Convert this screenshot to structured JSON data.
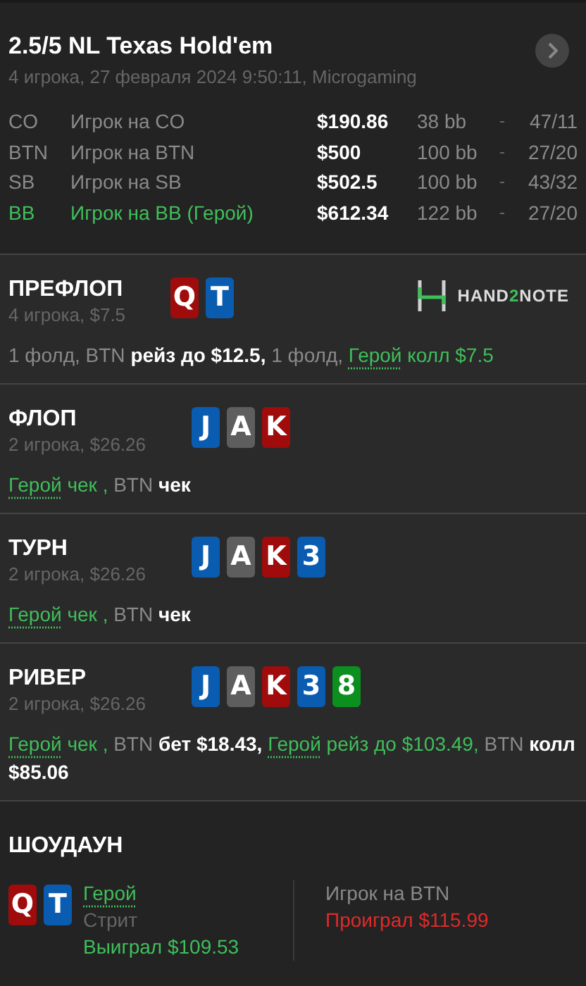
{
  "header": {
    "title": "2.5/5 NL Texas Hold'em",
    "subtitle": "4 игрока, 27 февраля 2024 9:50:11, Microgaming"
  },
  "players": [
    {
      "position": "CO",
      "name": "Игрок на CO",
      "stack": "$190.86",
      "bb": "38 bb",
      "stats": "47/11",
      "hero": false
    },
    {
      "position": "BTN",
      "name": "Игрок на BTN",
      "stack": "$500",
      "bb": "100 bb",
      "stats": "27/20",
      "hero": false
    },
    {
      "position": "SB",
      "name": "Игрок на SB",
      "stack": "$502.5",
      "bb": "100 bb",
      "stats": "43/32",
      "hero": false
    },
    {
      "position": "BB",
      "name": "Игрок на BB (Герой)",
      "stack": "$612.34",
      "bb": "122 bb",
      "stats": "27/20",
      "hero": true
    }
  ],
  "streets": [
    {
      "title": "ПРЕФЛОП",
      "info": "4 игрока, $7.5",
      "logo": {
        "parts": [
          {
            "text": "HAND",
            "accent": false
          },
          {
            "text": "2",
            "accent": true
          },
          {
            "text": "NOTE",
            "accent": false
          }
        ]
      },
      "cards": [
        {
          "rank": "Q",
          "color": "#a00c0c"
        },
        {
          "rank": "T",
          "color": "#0a5cb0"
        }
      ],
      "actions": [
        {
          "text": "1 фолд, BTN ",
          "kind": "muted"
        },
        {
          "text": "рейз до $12.5,",
          "kind": "bold"
        },
        {
          "text": " 1 фолд, ",
          "kind": "muted"
        },
        {
          "text": "Герой",
          "kind": "link"
        },
        {
          "text": " колл $7.5",
          "kind": "hero"
        }
      ]
    },
    {
      "title": "ФЛОП",
      "info": "2 игрока, $26.26",
      "cards": [
        {
          "rank": "J",
          "color": "#0a5cb0"
        },
        {
          "rank": "A",
          "color": "#5e5e5e"
        },
        {
          "rank": "K",
          "color": "#a00c0c"
        }
      ],
      "actions": [
        {
          "text": "Герой",
          "kind": "link"
        },
        {
          "text": " чек ,",
          "kind": "hero"
        },
        {
          "text": " BTN ",
          "kind": "muted"
        },
        {
          "text": "чек",
          "kind": "bold"
        }
      ]
    },
    {
      "title": "ТУРН",
      "info": "2 игрока, $26.26",
      "cards": [
        {
          "rank": "J",
          "color": "#0a5cb0"
        },
        {
          "rank": "A",
          "color": "#5e5e5e"
        },
        {
          "rank": "K",
          "color": "#a00c0c"
        },
        {
          "rank": "3",
          "color": "#0a5cb0"
        }
      ],
      "actions": [
        {
          "text": "Герой",
          "kind": "link"
        },
        {
          "text": " чек ,",
          "kind": "hero"
        },
        {
          "text": " BTN ",
          "kind": "muted"
        },
        {
          "text": "чек",
          "kind": "bold"
        }
      ]
    },
    {
      "title": "РИВЕР",
      "info": "2 игрока, $26.26",
      "cards": [
        {
          "rank": "J",
          "color": "#0a5cb0"
        },
        {
          "rank": "A",
          "color": "#5e5e5e"
        },
        {
          "rank": "K",
          "color": "#a00c0c"
        },
        {
          "rank": "3",
          "color": "#0a5cb0"
        },
        {
          "rank": "8",
          "color": "#0b8f1e"
        }
      ],
      "actions": [
        {
          "text": "Герой",
          "kind": "link"
        },
        {
          "text": " чек ,",
          "kind": "hero"
        },
        {
          "text": " BTN ",
          "kind": "muted"
        },
        {
          "text": "бет $18.43, ",
          "kind": "bold"
        },
        {
          "text": "Герой",
          "kind": "link"
        },
        {
          "text": " рейз до $103.49,",
          "kind": "hero"
        },
        {
          "text": " BTN ",
          "kind": "muted"
        },
        {
          "text": "колл $85.06",
          "kind": "bold"
        }
      ]
    }
  ],
  "showdown": {
    "title": "ШОУДАУН",
    "hero": {
      "cards": [
        {
          "rank": "Q",
          "color": "#a00c0c"
        },
        {
          "rank": "T",
          "color": "#0a5cb0"
        }
      ],
      "name": "Герой",
      "hand": "Стрит",
      "result": "Выиграл $109.53",
      "won": true
    },
    "opponent": {
      "name": "Игрок на BTN",
      "result": "Проиграл $115.99",
      "won": false
    }
  }
}
